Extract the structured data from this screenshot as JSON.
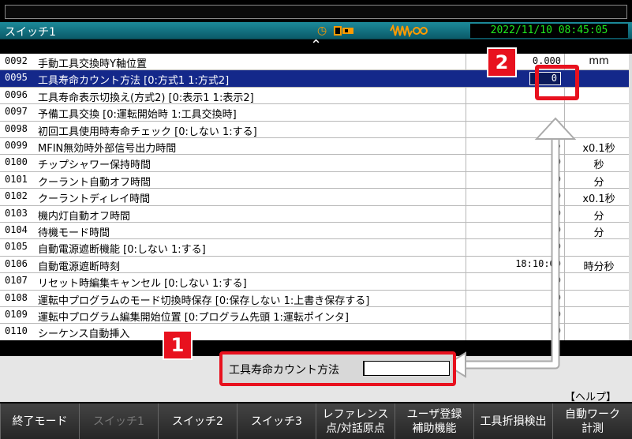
{
  "window": {
    "title": "スイッチ1",
    "datetime": "2022/11/10 08:45:05"
  },
  "rows": [
    {
      "num": "0092",
      "name": "手動工具交換時Y軸位置",
      "val": "0.000",
      "unit": "mm"
    },
    {
      "num": "0095",
      "name": "工具寿命カウント方法 [0:方式1 1:方式2]",
      "val": "0",
      "unit": ""
    },
    {
      "num": "0096",
      "name": "工具寿命表示切換え(方式2) [0:表示1 1:表示2]",
      "val": "",
      "unit": ""
    },
    {
      "num": "0097",
      "name": "予備工具交換 [0:運転開始時 1:工具交換時]",
      "val": "",
      "unit": ""
    },
    {
      "num": "0098",
      "name": "初回工具使用時寿命チェック [0:しない 1:する]",
      "val": "",
      "unit": ""
    },
    {
      "num": "0099",
      "name": "MFIN無効時外部信号出力時間",
      "val": "5",
      "unit": "x0.1秒"
    },
    {
      "num": "0100",
      "name": "チップシャワー保持時間",
      "val": "0",
      "unit": "秒"
    },
    {
      "num": "0101",
      "name": "クーラント自動オフ時間",
      "val": "0",
      "unit": "分"
    },
    {
      "num": "0102",
      "name": "クーラントディレイ時間",
      "val": "0",
      "unit": "x0.1秒"
    },
    {
      "num": "0103",
      "name": "機内灯自動オフ時間",
      "val": "0",
      "unit": "分"
    },
    {
      "num": "0104",
      "name": "待機モード時間",
      "val": "0",
      "unit": "分"
    },
    {
      "num": "0105",
      "name": "自動電源遮断機能 [0:しない 1:する]",
      "val": "0",
      "unit": ""
    },
    {
      "num": "0106",
      "name": "自動電源遮断時刻",
      "val": "18:10:00",
      "unit": "時分秒"
    },
    {
      "num": "0107",
      "name": "リセット時編集キャンセル [0:しない 1:する]",
      "val": "0",
      "unit": ""
    },
    {
      "num": "0108",
      "name": "運転中プログラムのモード切換時保存 [0:保存しない 1:上書き保存する]",
      "val": "0",
      "unit": ""
    },
    {
      "num": "0109",
      "name": "運転中プログラム編集開始位置 [0:プログラム先頭 1:運転ポインタ]",
      "val": "0",
      "unit": ""
    },
    {
      "num": "0110",
      "name": "シーケンス自動挿入",
      "val": "0",
      "unit": ""
    }
  ],
  "input": {
    "label": "工具寿命カウント方法",
    "value": ""
  },
  "help": "【ヘルプ】",
  "fkeys": [
    {
      "l1": "終了モード",
      "l2": "",
      "disabled": false
    },
    {
      "l1": "スイッチ1",
      "l2": "",
      "disabled": true
    },
    {
      "l1": "スイッチ2",
      "l2": "",
      "disabled": false
    },
    {
      "l1": "スイッチ3",
      "l2": "",
      "disabled": false
    },
    {
      "l1": "レファレンス",
      "l2": "点/対話原点",
      "disabled": false
    },
    {
      "l1": "ユーザ登録",
      "l2": "補助機能",
      "disabled": false
    },
    {
      "l1": "工具折損検出",
      "l2": "",
      "disabled": false
    },
    {
      "l1": "自動ワーク",
      "l2": "計測",
      "disabled": false
    }
  ],
  "annotations": {
    "badge1": "1",
    "badge2": "2"
  },
  "colors": {
    "highlight_red": "#e8111e",
    "selected_row": "#14288a",
    "clock_green": "#1ee81e"
  }
}
